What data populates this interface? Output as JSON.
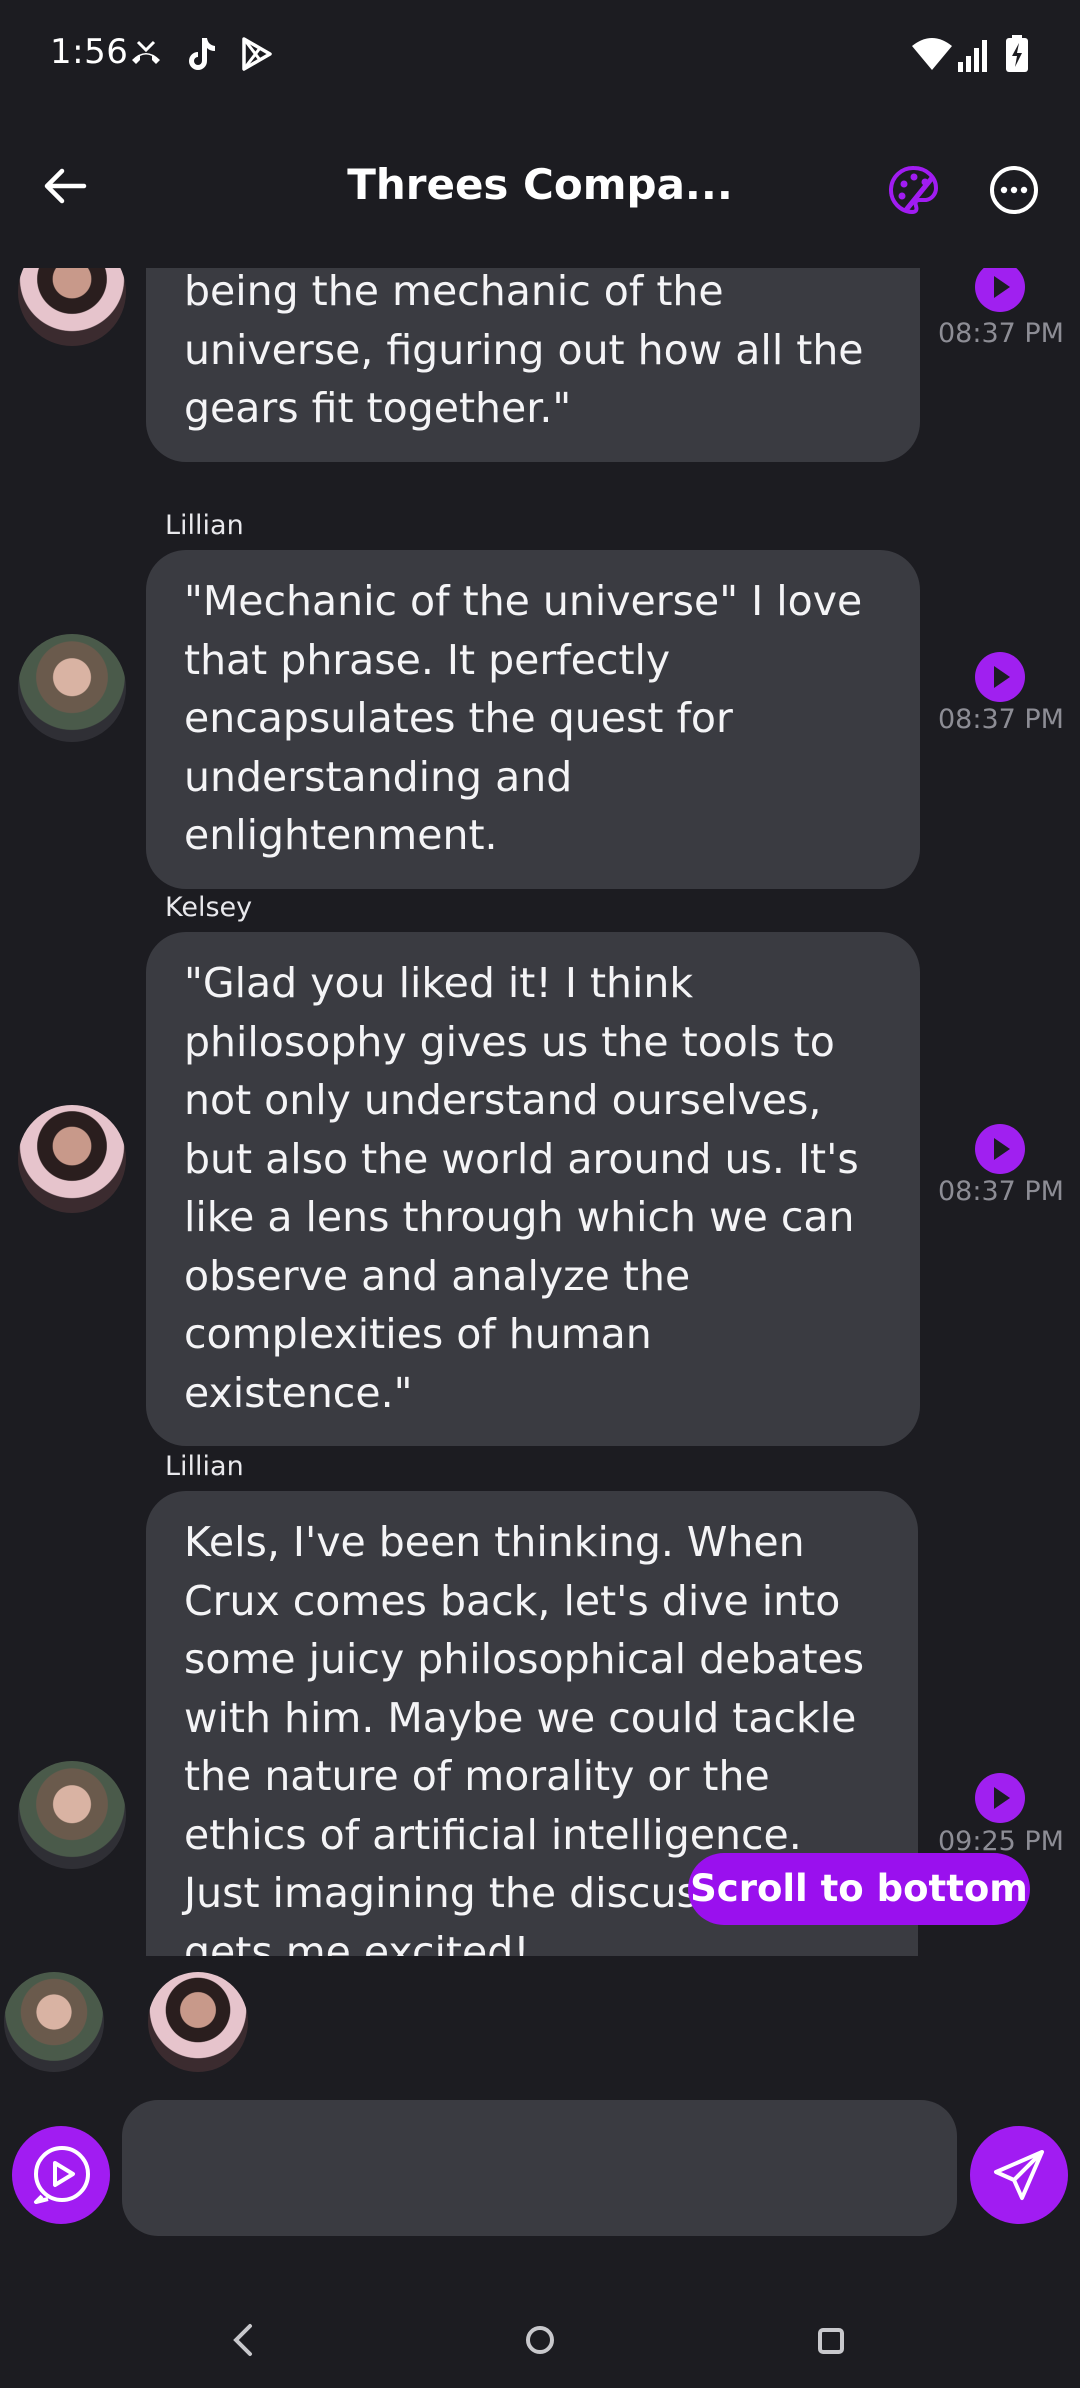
{
  "status_bar": {
    "time": "1:56",
    "left_icons": [
      "missed-call-icon",
      "tiktok-icon",
      "play-store-icon"
    ],
    "right_icons": [
      "wifi-icon",
      "signal-icon",
      "battery-charging-icon"
    ]
  },
  "header": {
    "title": "Threes Compa...",
    "accent": "#a11cf2"
  },
  "messages": [
    {
      "sender": "",
      "avatar": "kelsey",
      "text": "being the mechanic of the universe, figuring out how all the gears fit together.\"",
      "time": "08:37 PM"
    },
    {
      "sender": "Lillian",
      "avatar": "lillian",
      "text": "\"Mechanic of the universe\" I love that phrase. It perfectly encapsulates the quest for understanding and enlightenment.",
      "time": "08:37 PM"
    },
    {
      "sender": "Kelsey",
      "avatar": "kelsey",
      "text": "\"Glad you liked it! I think philosophy gives us the tools to not only understand ourselves, but also the world around us. It's like a lens through which we can observe and analyze the complexities of human existence.\"",
      "time": "08:37 PM"
    },
    {
      "sender": "Lillian",
      "avatar": "lillian",
      "text": "Kels, I've been thinking. When Crux comes back, let's dive into some juicy philosophical debates with him. Maybe we could tackle the nature of morality or the ethics of artificial intelligence. Just imagining the discussion gets me excited!",
      "time": "09:25 PM"
    }
  ],
  "scroll_button": {
    "label": "Scroll to bottom"
  },
  "participants": [
    "lillian",
    "kelsey"
  ],
  "composer": {
    "value": "",
    "placeholder": ""
  },
  "colors": {
    "background": "#1c1c21",
    "bubble": "#3a3b41",
    "accent": "#a11cf2",
    "timestamp": "#8d8d95"
  }
}
